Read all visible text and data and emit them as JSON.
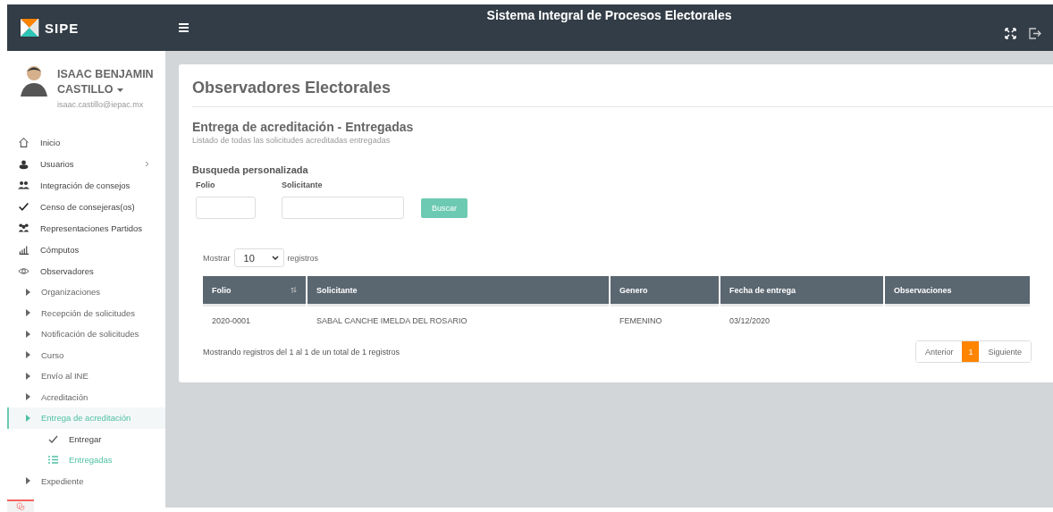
{
  "header": {
    "brand": "SIPE",
    "title": "Sistema Integral de Procesos Electorales"
  },
  "user": {
    "name": "ISAAC BENJAMIN CASTILLO",
    "email": "isaac.castillo@iepac.mx"
  },
  "menu": [
    {
      "label": "Inicio",
      "expandable": false
    },
    {
      "label": "Usuarios",
      "expandable": true
    },
    {
      "label": "Integración de consejos",
      "expandable": false
    },
    {
      "label": "Censo de consejeras(os)",
      "expandable": false
    },
    {
      "label": "Representaciones Partidos",
      "expandable": false
    },
    {
      "label": "Cómputos",
      "expandable": false
    },
    {
      "label": "Observadores",
      "expandable": false,
      "children": [
        {
          "label": "Organizaciones",
          "selected": false
        },
        {
          "label": "Recepción de solicitudes",
          "selected": false
        },
        {
          "label": "Notificación de solicitudes",
          "selected": false
        },
        {
          "label": "Curso",
          "selected": false
        },
        {
          "label": "Envío al INE",
          "selected": false
        },
        {
          "label": "Acreditación",
          "selected": false
        },
        {
          "label": "Entrega de acreditación",
          "selected": true,
          "children": [
            {
              "label": "Entregar",
              "kind": "check",
              "selected": false
            },
            {
              "label": "Entregadas",
              "kind": "list",
              "selected": true
            }
          ]
        },
        {
          "label": "Expediente",
          "selected": false
        }
      ]
    }
  ],
  "page": {
    "title": "Observadores Electorales",
    "section_title": "Entrega de acreditación - Entregadas",
    "section_subtitle": "Listado de todas las solicitudes acreditadas entregadas",
    "search": {
      "title": "Busqueda personalizada",
      "fields": [
        {
          "label": "Folio"
        },
        {
          "label": "Solicitante"
        }
      ],
      "button": "Buscar"
    },
    "length": {
      "prefix": "Mostrar",
      "value": "10",
      "suffix": "registros"
    },
    "table": {
      "columns": [
        {
          "label": "Folio",
          "sortable": true
        },
        {
          "label": "Solicitante",
          "sortable": false
        },
        {
          "label": "Genero",
          "sortable": false
        },
        {
          "label": "Fecha de entrega",
          "sortable": false
        },
        {
          "label": "Observaciones",
          "sortable": false
        }
      ],
      "rows": [
        [
          "2020-0001",
          "SABAL CANCHE IMELDA DEL ROSARIO",
          "FEMENINO",
          "03/12/2020",
          ""
        ]
      ]
    },
    "info": "Mostrando registros del 1 al 1 de un total de 1 registros",
    "pagination": [
      {
        "label": "Anterior",
        "selected": false
      },
      {
        "label": "1",
        "selected": true
      },
      {
        "label": "Siguiente",
        "selected": false
      }
    ]
  }
}
